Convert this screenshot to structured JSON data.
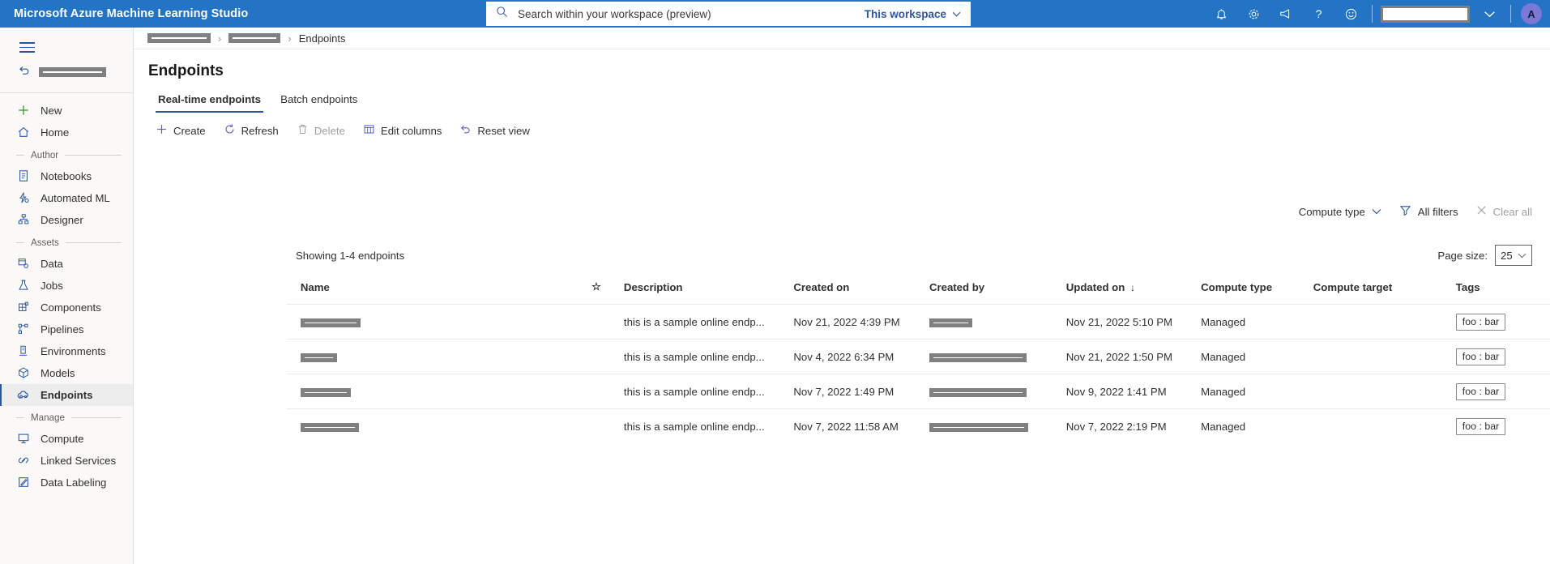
{
  "topbar": {
    "brand": "Microsoft Azure Machine Learning Studio",
    "search_placeholder": "Search within your workspace (preview)",
    "search_value": "",
    "scope_label": "This workspace",
    "icons": [
      "bell-icon",
      "gear-icon",
      "megaphone-icon",
      "help-icon",
      "feedback-icon"
    ],
    "avatar_initial": "A",
    "accent_color": "#2474c6"
  },
  "sidebar": {
    "groups": [
      {
        "label": "",
        "items": [
          {
            "label": "New",
            "icon": "plus-icon",
            "selected": false
          },
          {
            "label": "Home",
            "icon": "home-icon",
            "selected": false
          }
        ]
      },
      {
        "label": "Author",
        "items": [
          {
            "label": "Notebooks",
            "icon": "notebook-icon",
            "selected": false
          },
          {
            "label": "Automated ML",
            "icon": "automated-ml-icon",
            "selected": false
          },
          {
            "label": "Designer",
            "icon": "designer-icon",
            "selected": false
          }
        ]
      },
      {
        "label": "Assets",
        "items": [
          {
            "label": "Data",
            "icon": "data-icon",
            "selected": false
          },
          {
            "label": "Jobs",
            "icon": "jobs-flask-icon",
            "selected": false
          },
          {
            "label": "Components",
            "icon": "components-icon",
            "selected": false
          },
          {
            "label": "Pipelines",
            "icon": "pipelines-icon",
            "selected": false
          },
          {
            "label": "Environments",
            "icon": "environments-icon",
            "selected": false
          },
          {
            "label": "Models",
            "icon": "models-cube-icon",
            "selected": false
          },
          {
            "label": "Endpoints",
            "icon": "endpoints-icon",
            "selected": true
          }
        ]
      },
      {
        "label": "Manage",
        "items": [
          {
            "label": "Compute",
            "icon": "compute-monitor-icon",
            "selected": false
          },
          {
            "label": "Linked Services",
            "icon": "linked-services-icon",
            "selected": false
          },
          {
            "label": "Data Labeling",
            "icon": "data-labeling-icon",
            "selected": false
          }
        ]
      }
    ]
  },
  "breadcrumb": {
    "redacted_items": 2,
    "current": "Endpoints"
  },
  "page": {
    "title": "Endpoints",
    "tabs": [
      {
        "label": "Real-time endpoints",
        "active": true
      },
      {
        "label": "Batch endpoints",
        "active": false
      }
    ],
    "commands": [
      {
        "label": "Create",
        "icon": "plus-icon",
        "disabled": false
      },
      {
        "label": "Refresh",
        "icon": "refresh-icon",
        "disabled": false
      },
      {
        "label": "Delete",
        "icon": "trash-icon",
        "disabled": true
      },
      {
        "label": "Edit columns",
        "icon": "edit-columns-icon",
        "disabled": false
      },
      {
        "label": "Reset view",
        "icon": "reset-view-icon",
        "disabled": false
      }
    ],
    "filters": [
      {
        "label": "Compute type",
        "icon": "chevron-down-icon",
        "disabled": false
      },
      {
        "label": "All filters",
        "icon": "funnel-icon",
        "disabled": false
      },
      {
        "label": "Clear all",
        "icon": "close-icon",
        "disabled": true
      }
    ],
    "showing": "Showing 1-4 endpoints",
    "page_size_label": "Page size:",
    "page_size_value": "25"
  },
  "table": {
    "columns": [
      "Name",
      "",
      "Description",
      "Created on",
      "Created by",
      "Updated on",
      "Compute type",
      "Compute target",
      "Tags"
    ],
    "sort_column": "Updated on",
    "sort_direction": "desc",
    "rows": [
      {
        "name": "",
        "name_redacted_width": 74,
        "description": "this is a sample online endp...",
        "created_on": "Nov 21, 2022 4:39 PM",
        "created_by": "",
        "created_by_redacted_width": 53,
        "updated_on": "Nov 21, 2022 5:10 PM",
        "compute_type": "Managed",
        "compute_target": "",
        "tags": "foo : bar"
      },
      {
        "name": "",
        "name_redacted_width": 45,
        "description": "this is a sample online endp...",
        "created_on": "Nov 4, 2022 6:34 PM",
        "created_by": "",
        "created_by_redacted_width": 120,
        "updated_on": "Nov 21, 2022 1:50 PM",
        "compute_type": "Managed",
        "compute_target": "",
        "tags": "foo : bar"
      },
      {
        "name": "",
        "name_redacted_width": 62,
        "description": "this is a sample online endp...",
        "created_on": "Nov 7, 2022 1:49 PM",
        "created_by": "",
        "created_by_redacted_width": 120,
        "updated_on": "Nov 9, 2022 1:41 PM",
        "compute_type": "Managed",
        "compute_target": "",
        "tags": "foo : bar"
      },
      {
        "name": "",
        "name_redacted_width": 72,
        "description": "this is a sample online endp...",
        "created_on": "Nov 7, 2022 11:58 AM",
        "created_by": "",
        "created_by_redacted_width": 122,
        "updated_on": "Nov 7, 2022 2:19 PM",
        "compute_type": "Managed",
        "compute_target": "",
        "tags": "foo : bar"
      }
    ],
    "row_menu_label": "···"
  }
}
